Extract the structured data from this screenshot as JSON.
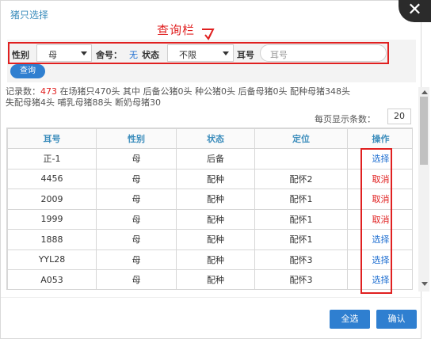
{
  "dialog": {
    "title": "猪只选择",
    "close_glyph": "✕"
  },
  "annotation": {
    "callout": "查询栏"
  },
  "filter": {
    "sex_label": "性别",
    "sex_value": "母",
    "pen_label": "舍号：",
    "pen_value": "无",
    "status_label": "状态",
    "status_value": "不限",
    "ear_label": "耳号",
    "ear_placeholder": "耳号",
    "query_button": "查询"
  },
  "summary": {
    "count_label": "记录数：",
    "count": "473",
    "details": "在场猪只470头 其中 后备公猪0头 种公猪0头 后备母猪0头 配种母猪348头",
    "details2": "失配母猪4头 哺乳母猪88头 断奶母猪30"
  },
  "per_page": {
    "label": "每页显示条数：",
    "value": "20"
  },
  "table": {
    "headers": [
      "耳号",
      "性别",
      "状态",
      "定位",
      "操作"
    ],
    "rows": [
      {
        "ear": "正-1",
        "sex": "母",
        "status": "后备",
        "location": "",
        "action": "选择",
        "action_type": "select"
      },
      {
        "ear": "4456",
        "sex": "母",
        "status": "配种",
        "location": "配怀2",
        "action": "取消",
        "action_type": "cancel"
      },
      {
        "ear": "2009",
        "sex": "母",
        "status": "配种",
        "location": "配怀1",
        "action": "取消",
        "action_type": "cancel"
      },
      {
        "ear": "1999",
        "sex": "母",
        "status": "配种",
        "location": "配怀1",
        "action": "取消",
        "action_type": "cancel"
      },
      {
        "ear": "1888",
        "sex": "母",
        "status": "配种",
        "location": "配怀1",
        "action": "选择",
        "action_type": "select"
      },
      {
        "ear": "YYL28",
        "sex": "母",
        "status": "配种",
        "location": "配怀3",
        "action": "选择",
        "action_type": "select"
      },
      {
        "ear": "A053",
        "sex": "母",
        "status": "配种",
        "location": "配怀3",
        "action": "选择",
        "action_type": "select"
      }
    ]
  },
  "footer": {
    "select_all": "全选",
    "confirm": "确认"
  },
  "colors": {
    "accent": "#2f7fd0",
    "highlight": "#e02020",
    "header_text": "#3c8dbc"
  }
}
